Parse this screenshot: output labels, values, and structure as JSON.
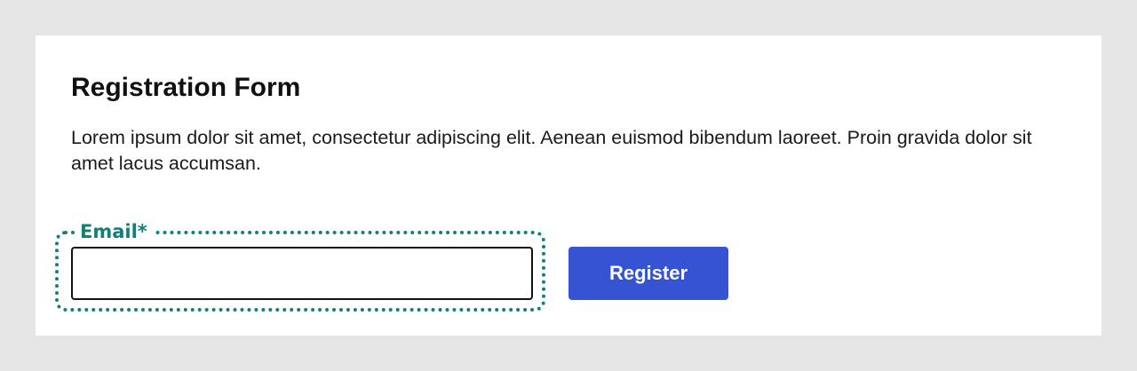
{
  "form": {
    "title": "Registration Form",
    "description": "Lorem ipsum dolor sit amet, consectetur adipiscing elit. Aenean euismod bibendum laoreet. Proin gravida dolor sit amet lacus accumsan.",
    "email_label": "Email*",
    "email_value": "",
    "email_placeholder": "",
    "register_label": "Register"
  },
  "colors": {
    "page_background": "#e6e6e6",
    "card_background": "#ffffff",
    "focus_ring": "#137f7a",
    "button_background": "#3653d3",
    "button_text": "#ffffff"
  }
}
